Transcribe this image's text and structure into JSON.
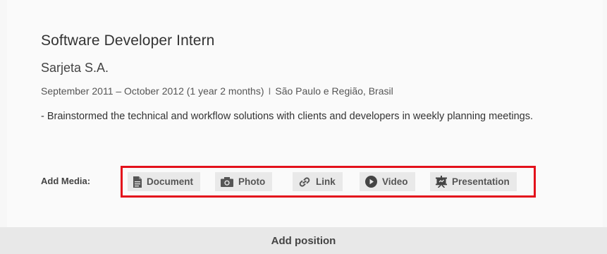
{
  "position": {
    "title": "Software Developer Intern",
    "company": "Sarjeta S.A.",
    "dates": "September 2011 – October 2012 (1 year 2 months)",
    "separator": "I",
    "location": "São Paulo e Região, Brasil",
    "description": "- Brainstormed the technical and workflow solutions with clients and developers in weekly planning meetings."
  },
  "media": {
    "label": "Add Media:",
    "buttons": [
      {
        "label": "Document",
        "icon": "document-icon"
      },
      {
        "label": "Photo",
        "icon": "camera-icon"
      },
      {
        "label": "Link",
        "icon": "link-icon"
      },
      {
        "label": "Video",
        "icon": "play-icon"
      },
      {
        "label": "Presentation",
        "icon": "presentation-icon"
      }
    ],
    "highlight_color": "#e3111b"
  },
  "footer": {
    "add_position_label": "Add position"
  }
}
